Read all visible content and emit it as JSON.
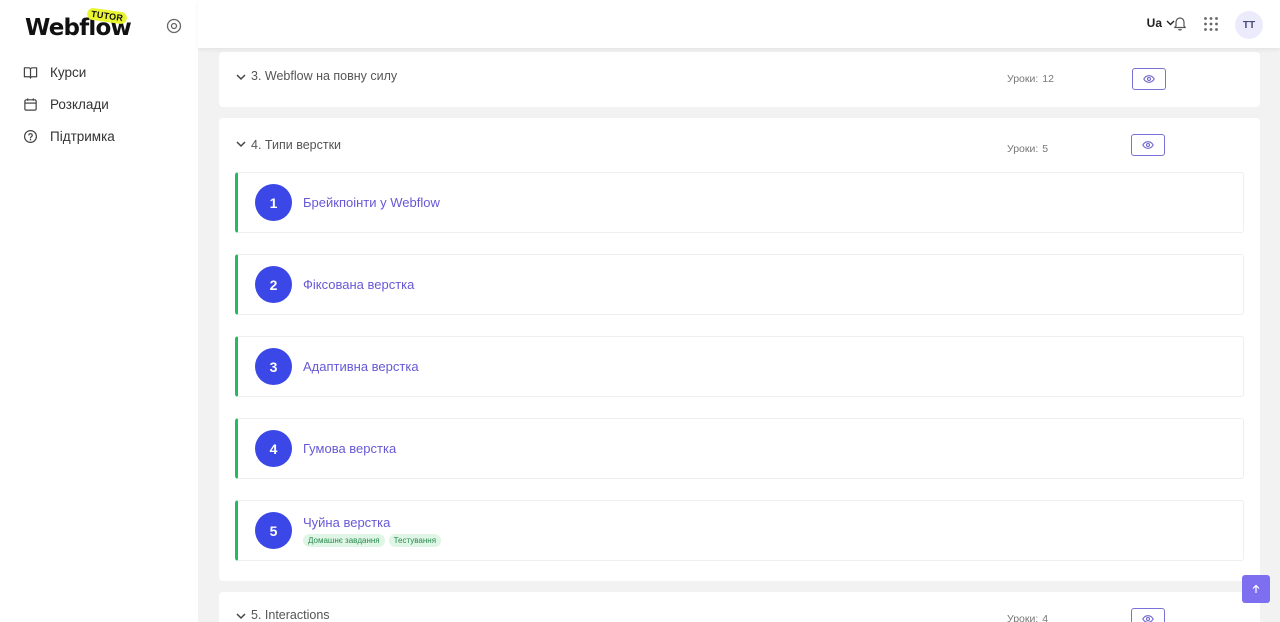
{
  "app": {
    "logo_text": "Webflow",
    "logo_badge": "TUTOR"
  },
  "sidebar": {
    "items": [
      {
        "label": "Курси",
        "icon": "book-icon"
      },
      {
        "label": "Розклади",
        "icon": "calendar-icon"
      },
      {
        "label": "Підтримка",
        "icon": "help-circle-icon"
      }
    ]
  },
  "topbar": {
    "language": "Ua",
    "avatar_initials": "TT"
  },
  "sections": [
    {
      "title": "3. Webflow на повну силу",
      "lessons_label": "Уроки:",
      "lessons_count": "12"
    },
    {
      "title": "4. Типи верстки",
      "lessons_label": "Уроки:",
      "lessons_count": "5",
      "lessons": [
        {
          "num": "1",
          "title": "Брейкпоінти у Webflow"
        },
        {
          "num": "2",
          "title": "Фіксована верстка"
        },
        {
          "num": "3",
          "title": "Адаптивна верстка"
        },
        {
          "num": "4",
          "title": "Гумова верстка"
        },
        {
          "num": "5",
          "title": "Чуйна верстка",
          "tags": [
            "Домашнє завдання",
            "Тестування"
          ]
        }
      ]
    },
    {
      "title": "5. Interactions",
      "lessons_label": "Уроки:",
      "lessons_count": "4"
    }
  ],
  "colors": {
    "accent": "#3b47e6",
    "lesson_title": "#6758d6",
    "lesson_border": "#25b960",
    "scroll_button": "#7e6ef0"
  }
}
